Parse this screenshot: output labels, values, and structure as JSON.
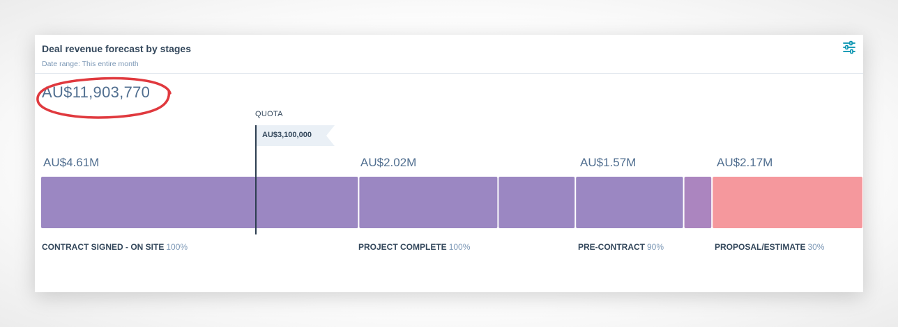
{
  "card": {
    "title": "Deal revenue forecast by stages",
    "subtitle": "Date range: This entire month",
    "filter_icon": "sliders-icon"
  },
  "total": "AU$11,903,770",
  "quota": {
    "label": "QUOTA",
    "value_label": "AU$3,100,000",
    "value": 3100000
  },
  "colors": {
    "purple": "#9b87c2",
    "purple_light": "#ab85bf",
    "salmon": "#f5989d",
    "quota_line": "#2d3e50",
    "annotation": "#e0393e"
  },
  "value_labels": [
    "AU$4.61M",
    "AU$2.02M",
    "AU$1.57M",
    "AU$2.17M"
  ],
  "stages": [
    {
      "name": "CONTRACT SIGNED - ON SITE",
      "percent": "100%"
    },
    {
      "name": "PROJECT COMPLETE",
      "percent": "100%"
    },
    {
      "name": "PRE-CONTRACT",
      "percent": "90%"
    },
    {
      "name": "PROPOSAL/ESTIMATE",
      "percent": "30%"
    }
  ],
  "chart_data": {
    "type": "bar",
    "orientation": "horizontal-stacked",
    "title": "Deal revenue forecast by stages",
    "segments": [
      {
        "stage": "CONTRACT SIGNED - ON SITE",
        "value": 4610000,
        "color": "#9b87c2"
      },
      {
        "stage": "PROJECT COMPLETE",
        "value": 2020000,
        "color": "#9b87c2"
      },
      {
        "stage": "",
        "value": 1120000,
        "color": "#9b87c2"
      },
      {
        "stage": "PRE-CONTRACT",
        "value": 1570000,
        "color": "#9b87c2"
      },
      {
        "stage": "",
        "value": 410000,
        "color": "#ab85bf"
      },
      {
        "stage": "PROPOSAL/ESTIMATE",
        "value": 2170000,
        "color": "#f5989d"
      }
    ],
    "total": 11903770,
    "quota": 3100000
  }
}
